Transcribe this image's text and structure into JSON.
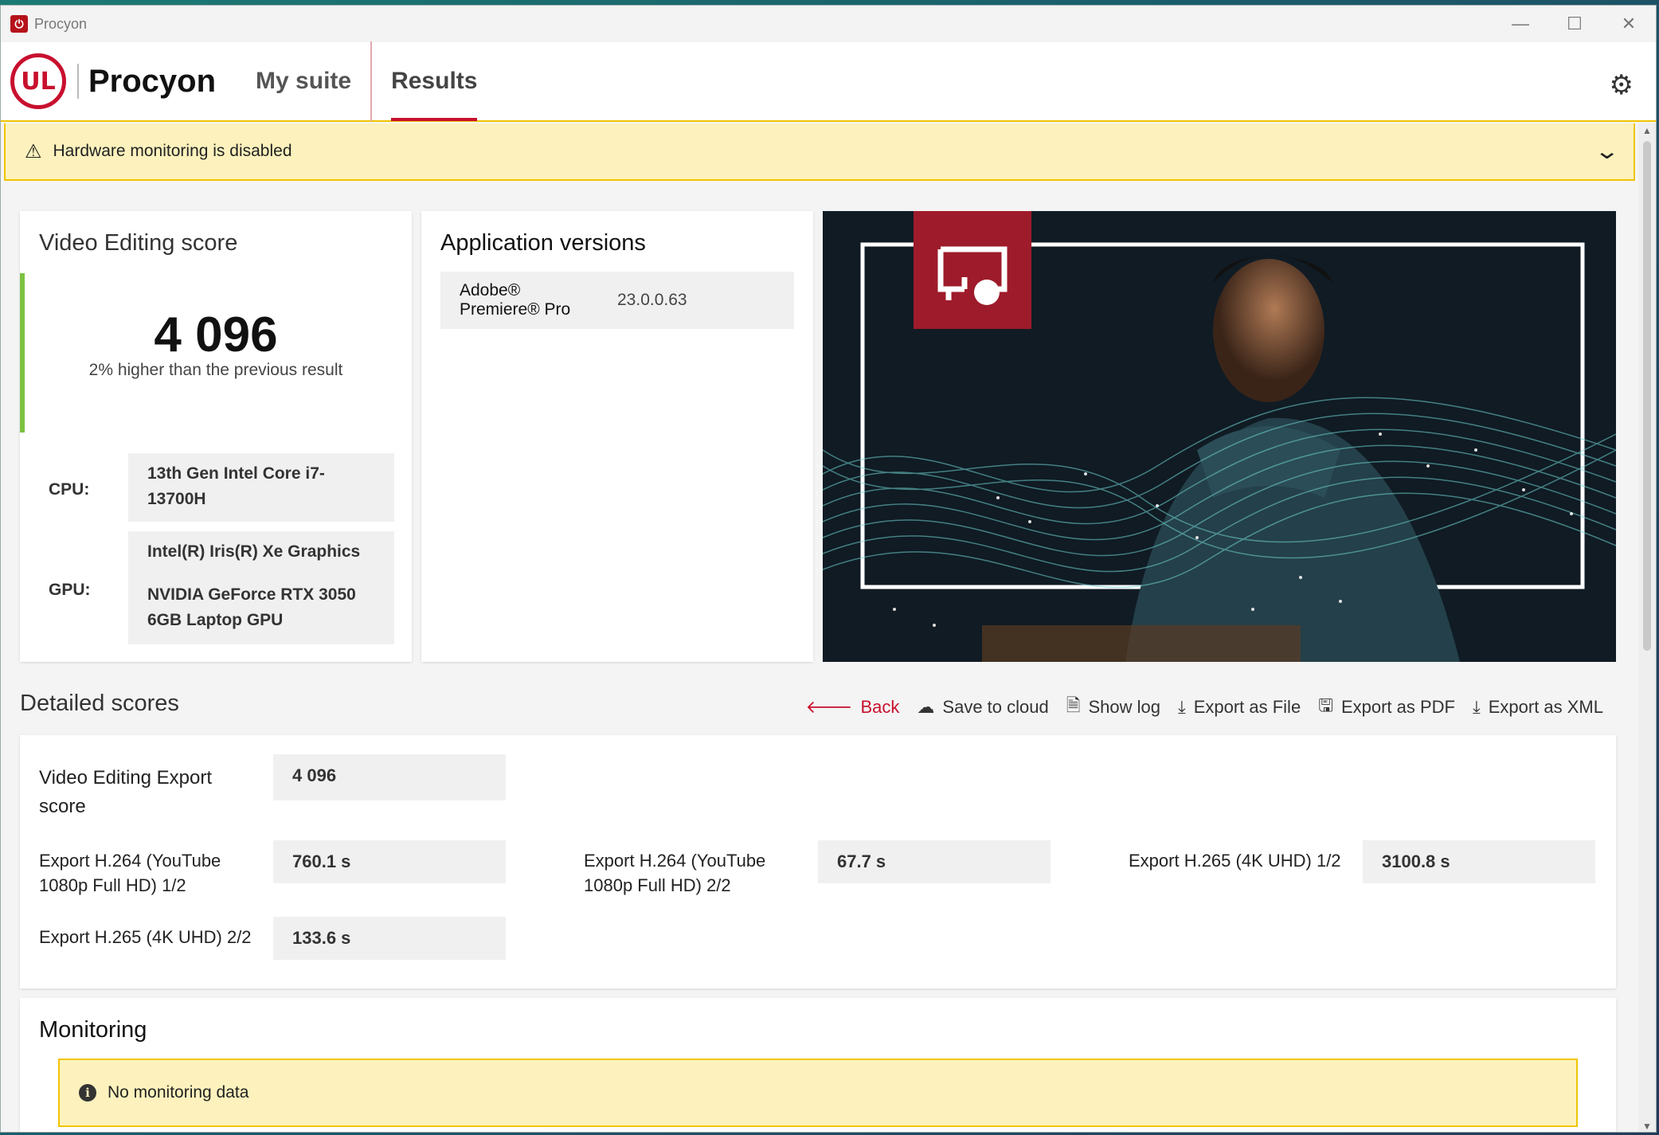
{
  "window": {
    "title": "Procyon",
    "controls": {
      "minimize": "—",
      "maximize": "☐",
      "close": "✕"
    }
  },
  "header": {
    "logo_text": "UL",
    "brand": "Procyon",
    "tabs": [
      {
        "label": "My suite",
        "active": false
      },
      {
        "label": "Results",
        "active": true
      }
    ]
  },
  "warning_banner": {
    "text": "Hardware monitoring is disabled"
  },
  "score_card": {
    "title": "Video Editing score",
    "score": "4 096",
    "comparison": "2% higher than the previous result",
    "cpu_label": "CPU:",
    "cpu_value": "13th Gen Intel Core i7-13700H",
    "gpu_label": "GPU:",
    "gpu_values": [
      "Intel(R) Iris(R) Xe Graphics",
      "NVIDIA GeForce RTX 3050 6GB Laptop GPU"
    ]
  },
  "versions_card": {
    "title": "Application versions",
    "app": "Adobe® Premiere® Pro",
    "version": "23.0.0.63"
  },
  "detailed": {
    "title": "Detailed scores",
    "actions": {
      "back": "Back",
      "save_cloud": "Save to cloud",
      "show_log": "Show log",
      "export_file": "Export as File",
      "export_pdf": "Export as PDF",
      "export_xml": "Export as XML"
    },
    "overall_label": "Video Editing Export score",
    "overall_value": "4 096",
    "items": [
      {
        "label": "Export H.264 (YouTube 1080p Full HD) 1/2",
        "value": "760.1 s"
      },
      {
        "label": "Export H.264 (YouTube 1080p Full HD) 2/2",
        "value": "67.7 s"
      },
      {
        "label": "Export H.265 (4K UHD) 1/2",
        "value": "3100.8 s"
      },
      {
        "label": "Export H.265 (4K UHD) 2/2",
        "value": "133.6 s"
      }
    ]
  },
  "monitoring": {
    "title": "Monitoring",
    "message": "No monitoring data"
  },
  "colors": {
    "accent": "#c8102e",
    "score_bar": "#7cc242",
    "warning_bg": "#fdf2bd",
    "warning_border": "#f0c400"
  }
}
